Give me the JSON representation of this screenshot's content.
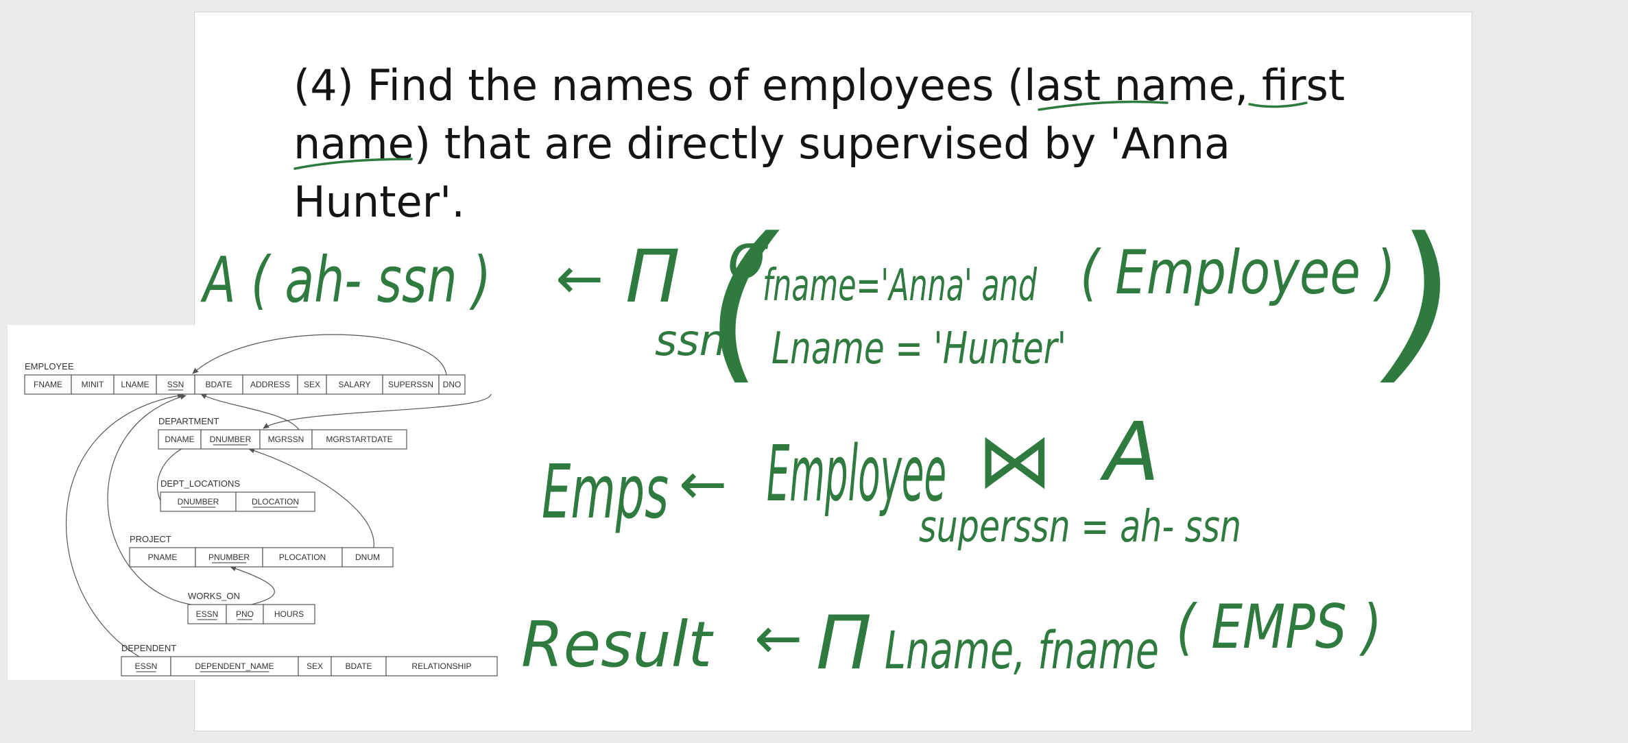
{
  "colors": {
    "ink": "#2e7a3f",
    "text": "#141414",
    "schema_line": "#555555",
    "page_bg": "#ebebeb",
    "slide_bg": "#ffffff"
  },
  "question": {
    "lines": [
      "(4) Find the names of employees (last name, first",
      "name) that are directly supervised by 'Anna",
      "Hunter'."
    ]
  },
  "schema": {
    "tables": [
      {
        "title": "EMPLOYEE",
        "columns": [
          "FNAME",
          "MINIT",
          "LNAME",
          "SSN",
          "BDATE",
          "ADDRESS",
          "SEX",
          "SALARY",
          "SUPERSSN",
          "DNO"
        ],
        "keys": [
          "SSN"
        ]
      },
      {
        "title": "DEPARTMENT",
        "columns": [
          "DNAME",
          "DNUMBER",
          "MGRSSN",
          "MGRSTARTDATE"
        ],
        "keys": [
          "DNUMBER"
        ]
      },
      {
        "title": "DEPT_LOCATIONS",
        "columns": [
          "DNUMBER",
          "DLOCATION"
        ],
        "keys": [
          "DNUMBER",
          "DLOCATION"
        ]
      },
      {
        "title": "PROJECT",
        "columns": [
          "PNAME",
          "PNUMBER",
          "PLOCATION",
          "DNUM"
        ],
        "keys": [
          "PNUMBER"
        ]
      },
      {
        "title": "WORKS_ON",
        "columns": [
          "ESSN",
          "PNO",
          "HOURS"
        ],
        "keys": [
          "ESSN",
          "PNO"
        ]
      },
      {
        "title": "DEPENDENT",
        "columns": [
          "ESSN",
          "DEPENDENT_NAME",
          "SEX",
          "BDATE",
          "RELATIONSHIP"
        ],
        "keys": [
          "ESSN",
          "DEPENDENT_NAME"
        ]
      }
    ]
  },
  "handwriting": {
    "step1": {
      "lhs": "A ( ah- ssn )",
      "arrow": "←",
      "pi": "Π",
      "pi_sub": "ssn",
      "open_paren": "(",
      "sigma": "σ",
      "cond1": "fname='Anna' and",
      "cond2": "Lname = 'Hunter'",
      "relation": "( Employee )",
      "close_paren": ")"
    },
    "step2": {
      "lhs": "Emps",
      "arrow": "←",
      "rel1": "Employee",
      "join": "⋈",
      "rel2": "A",
      "join_cond": "superssn = ah- ssn"
    },
    "step3": {
      "lhs": "Result",
      "arrow": "←",
      "pi": "Π",
      "attrs": "Lname, fname",
      "relation": "( EMPS )"
    }
  }
}
